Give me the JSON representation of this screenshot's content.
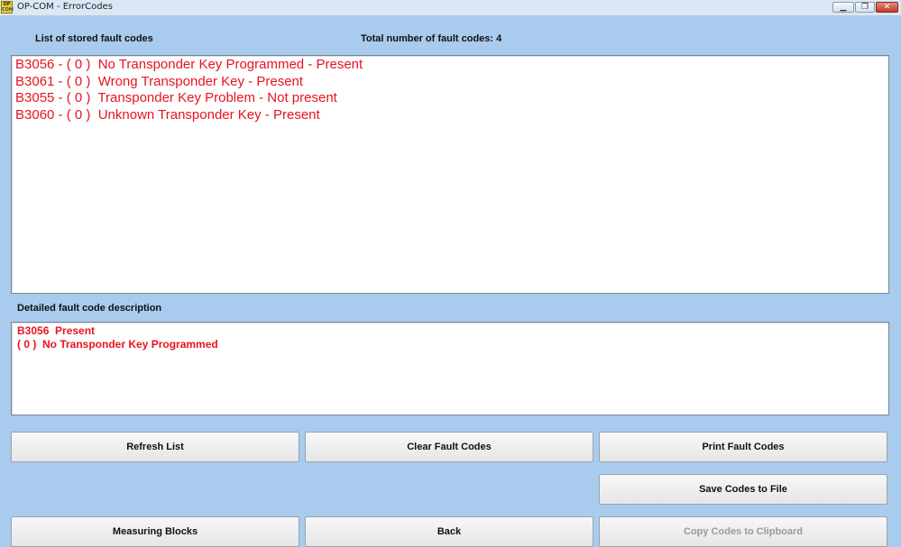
{
  "window": {
    "title": "OP-COM - ErrorCodes",
    "icon_top": "OP",
    "icon_bottom": "COM",
    "min_glyph": "▁",
    "max_glyph": "❐",
    "close_glyph": "✕"
  },
  "header": {
    "list_label": "List of stored fault codes",
    "total_label": "Total number of fault codes:  4"
  },
  "fault_codes": [
    "B3056 - ( 0 )  No Transponder Key Programmed - Present",
    "B3061 - ( 0 )  Wrong Transponder Key - Present",
    "B3055 - ( 0 )  Transponder Key Problem - Not present",
    "B3060 - ( 0 )  Unknown Transponder Key - Present"
  ],
  "detail": {
    "label": "Detailed fault code description",
    "line1": "B3056  Present",
    "line2": "( 0 )  No Transponder Key Programmed"
  },
  "buttons": {
    "refresh": "Refresh List",
    "clear": "Clear Fault Codes",
    "print": "Print Fault Codes",
    "save": "Save Codes to File",
    "measuring": "Measuring Blocks",
    "back": "Back",
    "copy": "Copy Codes to Clipboard"
  },
  "colors": {
    "background": "#a9cbee",
    "fault_text": "#e8131f",
    "disabled_text": "#9a9a9a"
  }
}
